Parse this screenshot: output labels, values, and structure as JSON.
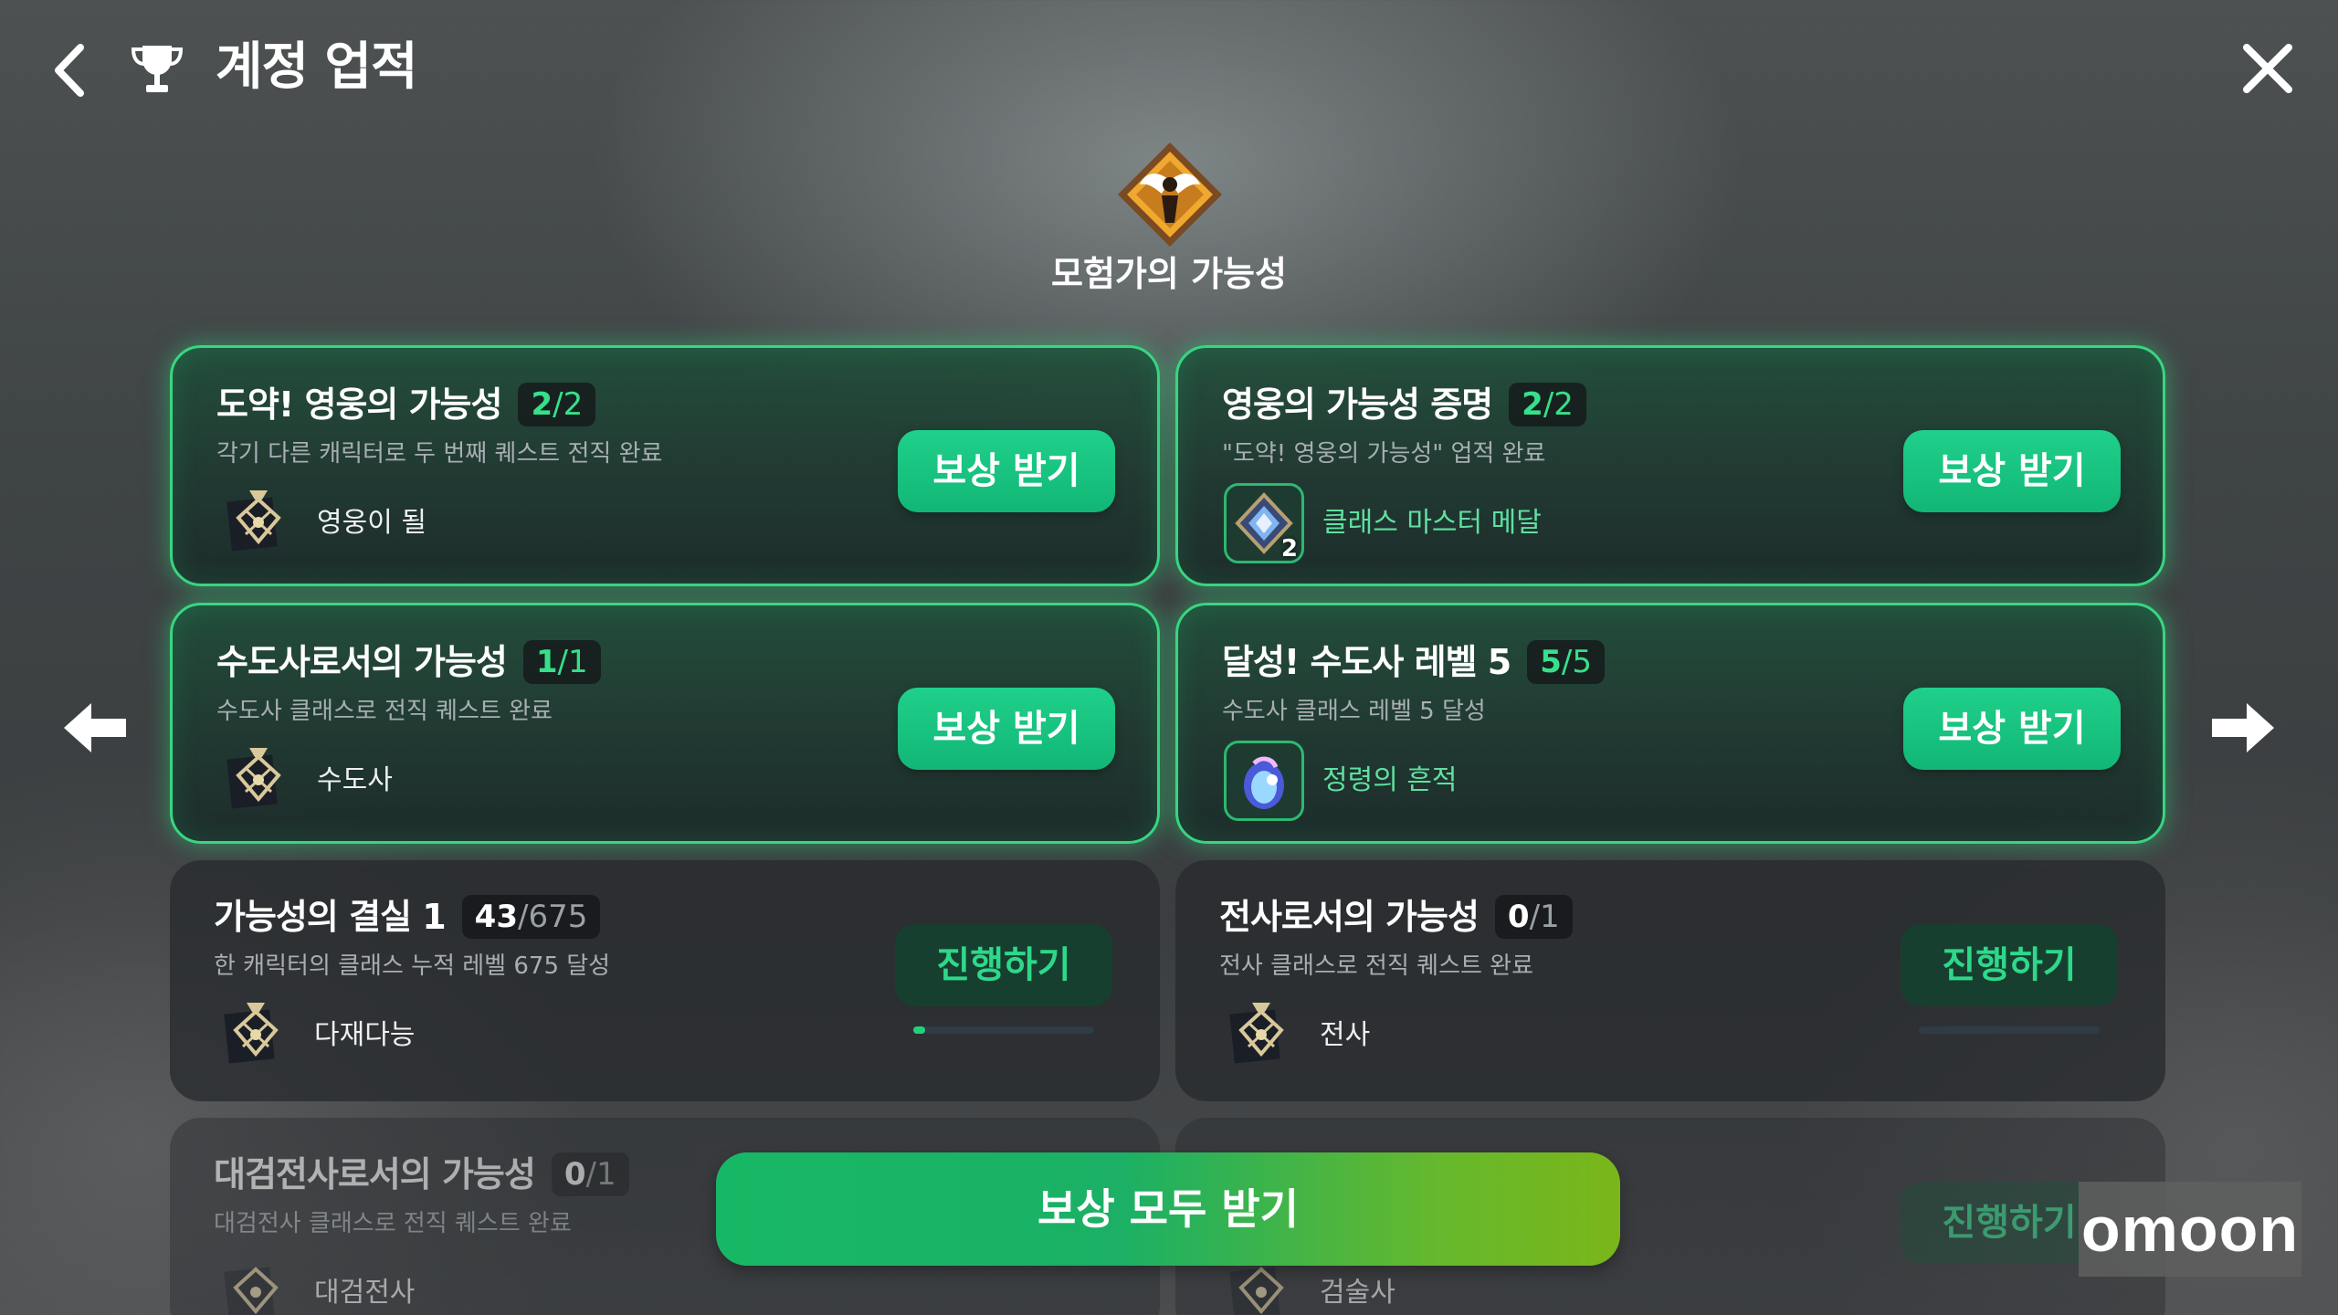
{
  "header": {
    "title": "계정 업적",
    "back_icon": "chevron-left-icon",
    "trophy_icon": "trophy-icon",
    "close_icon": "close-icon"
  },
  "category": {
    "title": "모험가의 가능성",
    "icon": "winged-adventurer-emblem-icon"
  },
  "achievements": [
    {
      "title": "도약! 영웅의 가능성",
      "progress_current": "2",
      "progress_total": "/2",
      "description": "각기 다른 캐릭터로 두 번째 퀘스트 전직 완료",
      "reward_icon": "title-plaque-icon",
      "reward_label": "영웅이 될",
      "button": "보상 받기",
      "state": "complete"
    },
    {
      "title": "영웅의 가능성 증명",
      "progress_current": "2",
      "progress_total": "/2",
      "description": "\"도약! 영웅의 가능성\" 업적 완료",
      "reward_icon": "class-master-medal-icon",
      "reward_count": "2",
      "reward_label": "클래스 마스터 메달",
      "button": "보상 받기",
      "state": "complete"
    },
    {
      "title": "수도사로서의 가능성",
      "progress_current": "1",
      "progress_total": "/1",
      "description": "수도사 클래스로 전직 퀘스트 완료",
      "reward_icon": "title-plaque-icon",
      "reward_label": "수도사",
      "button": "보상 받기",
      "state": "complete"
    },
    {
      "title": "달성! 수도사 레벨 5",
      "progress_current": "5",
      "progress_total": "/5",
      "description": "수도사 클래스 레벨 5 달성",
      "reward_icon": "spirit-trace-icon",
      "reward_label": "정령의 흔적",
      "button": "보상 받기",
      "state": "complete"
    },
    {
      "title": "가능성의 결실 1",
      "progress_current": "43",
      "progress_total": "/675",
      "progress_fraction": 0.064,
      "description": "한 캐릭터의 클래스 누적 레벨 675 달성",
      "reward_icon": "title-plaque-icon",
      "reward_label": "다재다능",
      "button": "진행하기",
      "state": "in-progress"
    },
    {
      "title": "전사로서의 가능성",
      "progress_current": "0",
      "progress_total": "/1",
      "progress_fraction": 0,
      "description": "전사 클래스로 전직 퀘스트 완료",
      "reward_icon": "title-plaque-icon",
      "reward_label": "전사",
      "button": "진행하기",
      "state": "in-progress"
    },
    {
      "title": "대검전사로서의 가능성",
      "progress_current": "0",
      "progress_total": "/1",
      "progress_fraction": 0,
      "description": "대검전사 클래스로 전직 퀘스트 완료",
      "reward_icon": "title-plaque-icon",
      "reward_label": "대검전사",
      "button": "진행하기",
      "state": "in-progress"
    },
    {
      "title": "",
      "description": "",
      "reward_icon": "title-plaque-icon",
      "reward_label": "검술사",
      "button": "진행하기",
      "state": "in-progress"
    }
  ],
  "navigation": {
    "prev_icon": "arrow-left-icon",
    "next_icon": "arrow-right-icon"
  },
  "claim_all_label": "보상 모두 받기",
  "watermark": "omoon",
  "colors": {
    "accent_green": "#1fd08a",
    "complete_border": "#38d680",
    "go_button_bg": "#164030",
    "go_button_text": "#2ed88a",
    "claim_all_start": "#17b865",
    "claim_all_end": "#7ab61a"
  }
}
